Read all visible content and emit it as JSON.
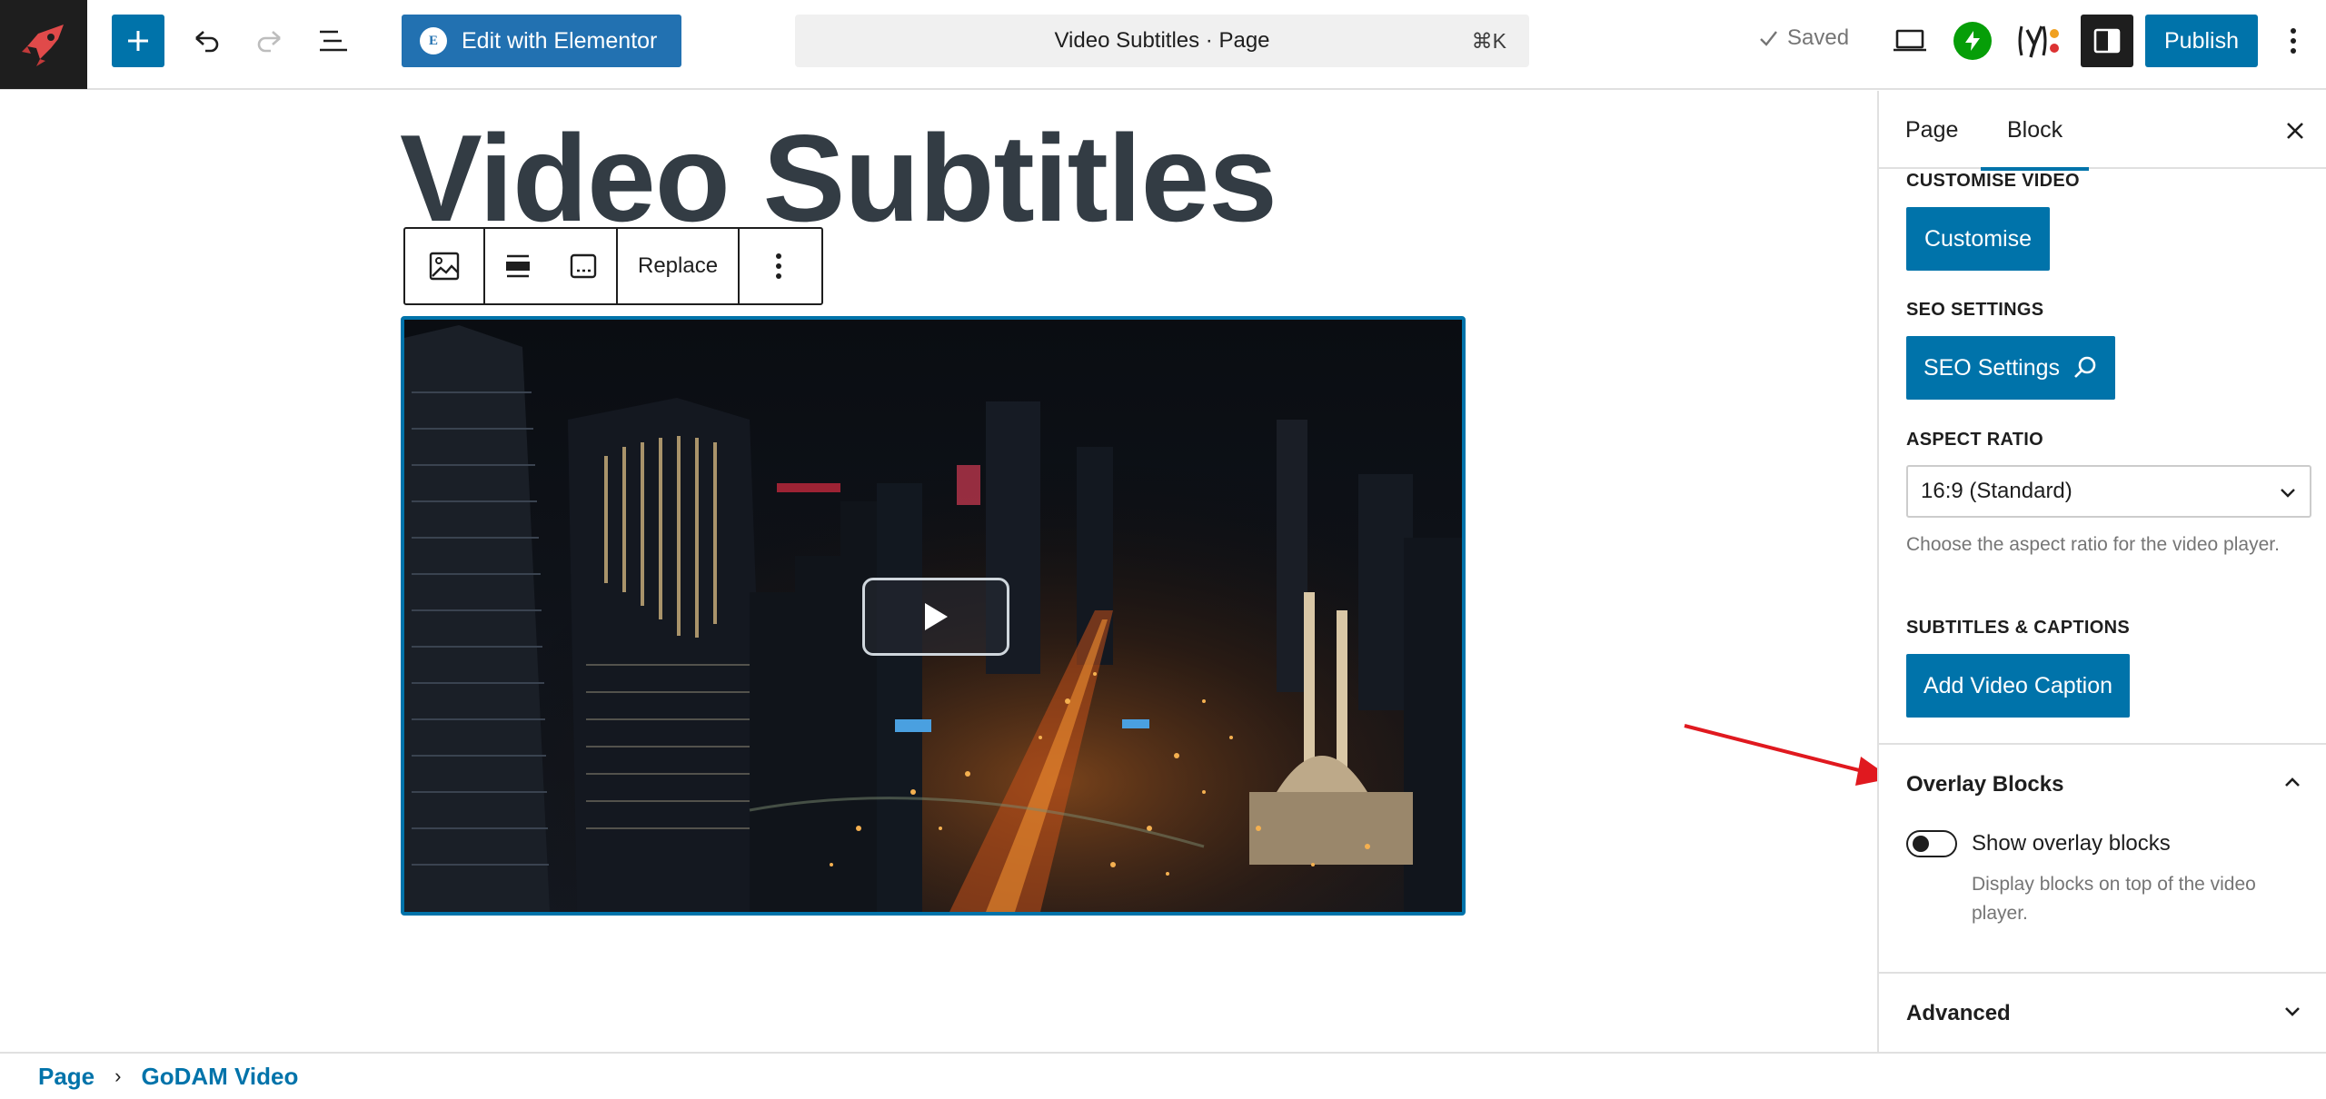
{
  "topbar": {
    "elementor_label": "Edit with Elementor",
    "document_title": "Video Subtitles · Page",
    "shortcut": "⌘K",
    "saved_label": "Saved",
    "publish_label": "Publish"
  },
  "canvas": {
    "page_title": "Video Subtitles",
    "toolbar": {
      "replace_label": "Replace"
    }
  },
  "sidebar": {
    "tabs": [
      {
        "label": "Page"
      },
      {
        "label": "Block"
      }
    ],
    "active_tab": "Block",
    "customise_video": {
      "label": "CUSTOMISE VIDEO",
      "button": "Customise"
    },
    "seo_settings": {
      "label": "SEO SETTINGS",
      "button": "SEO Settings"
    },
    "aspect_ratio": {
      "label": "ASPECT RATIO",
      "selected": "16:9 (Standard)",
      "help": "Choose the aspect ratio for the video player."
    },
    "subtitles": {
      "label": "SUBTITLES & CAPTIONS",
      "button": "Add Video Caption"
    },
    "overlay_blocks": {
      "title": "Overlay Blocks",
      "toggle_label": "Show overlay blocks",
      "toggle_on": false,
      "help": "Display blocks on top of the video player."
    },
    "advanced": {
      "title": "Advanced"
    }
  },
  "breadcrumb": [
    {
      "label": "Page"
    },
    {
      "label": "GoDAM Video"
    }
  ],
  "colors": {
    "accent": "#0073aa",
    "dark": "#1e1e1e",
    "muted": "#757575",
    "annotation_arrow": "#e0191f",
    "jetpack": "#069e08"
  }
}
